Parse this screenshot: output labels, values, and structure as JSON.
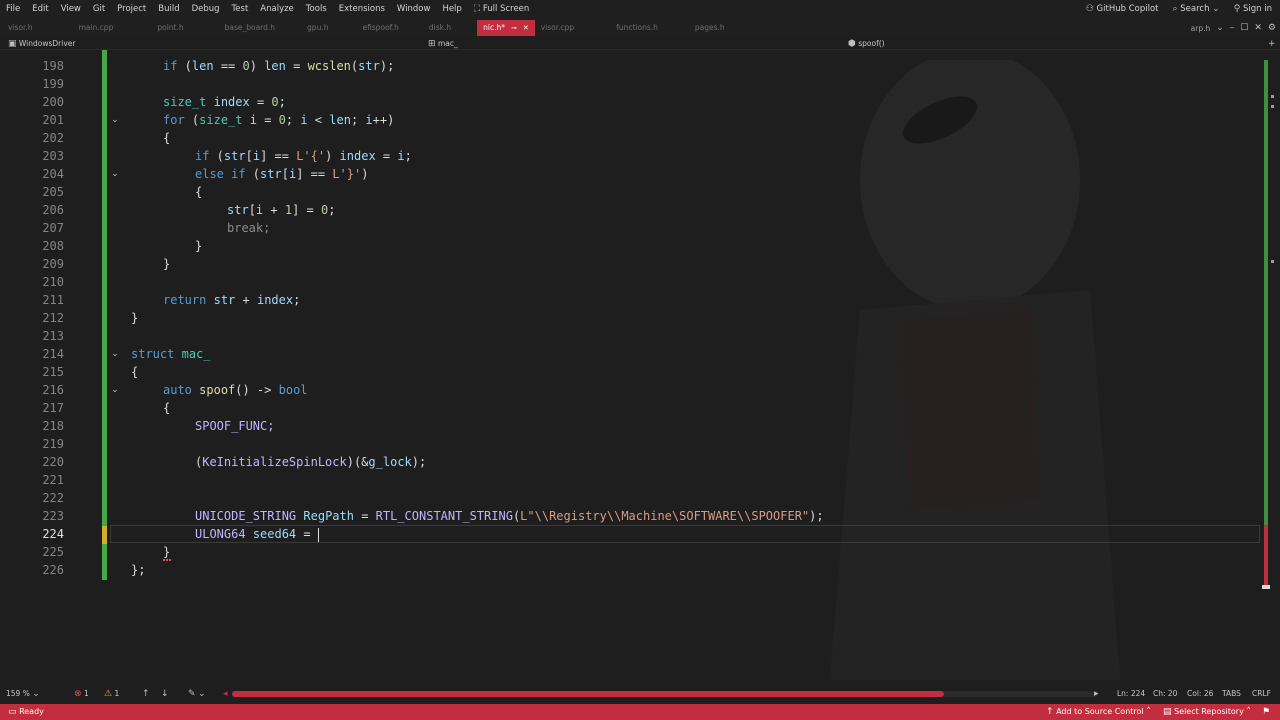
{
  "menu": [
    "File",
    "Edit",
    "View",
    "Git",
    "Project",
    "Build",
    "Debug",
    "Test",
    "Analyze",
    "Tools",
    "Extensions",
    "Window",
    "Help"
  ],
  "fullscreen_label": "Full Screen",
  "copilot_label": "GitHub Copilot",
  "search_label": "Search",
  "signin_label": "Sign in",
  "tabs": [
    "visor.h",
    "main.cpp",
    "point.h",
    "base_board.h",
    "gpu.h",
    "efispoof.h",
    "disk.h",
    "nic.h*",
    "visor.cpp",
    "functions.h",
    "pages.h"
  ],
  "active_tab": "nic.h*",
  "tab_right": "arp.h",
  "nav": {
    "project": "WindowsDriver",
    "scope": "mac_",
    "member": "spoof()"
  },
  "line_numbers": [
    "198",
    "199",
    "200",
    "201",
    "202",
    "203",
    "204",
    "205",
    "206",
    "207",
    "208",
    "209",
    "210",
    "211",
    "212",
    "213",
    "214",
    "215",
    "216",
    "217",
    "218",
    "219",
    "220",
    "221",
    "222",
    "223",
    "224",
    "225",
    "226"
  ],
  "code": {
    "l198": "if (len == 0) len = wcslen(str);",
    "l200": "size_t index = 0;",
    "l201": "for (size_t i = 0; i < len; i++)",
    "l202": "{",
    "l203": "if (str[i] == L'{') index = i;",
    "l204": "else if (str[i] == L'}')",
    "l205": "{",
    "l206": "str[i + 1] = 0;",
    "l207": "break;",
    "l208": "}",
    "l209": "}",
    "l211": "return str + index;",
    "l212": "}",
    "l214": "struct mac_",
    "l215": "{",
    "l216": "auto spoof() -> bool",
    "l217": "{",
    "l218": "SPOOF_FUNC;",
    "l220": "(KeInitializeSpinLock)(&g_lock);",
    "l223": "UNICODE_STRING RegPath = RTL_CONSTANT_STRING(L\"\\\\Registry\\\\Machine\\SOFTWARE\\\\SPOOFER\");",
    "l224": "ULONG64 seed64 = ",
    "l225": "}",
    "l226": "};"
  },
  "status_row": {
    "zoom": "159 %",
    "errors": "1",
    "warnings": "1",
    "ln": "Ln: 224",
    "ch": "Ch: 20",
    "col": "Col: 26",
    "tabs": "TABS",
    "eol": "CRLF"
  },
  "statusbar": {
    "ready": "Ready",
    "source_control": "Add to Source Control",
    "repository": "Select Repository"
  },
  "colors": {
    "accent": "#c22d3f",
    "background": "#1e1e1e",
    "change_green": "#46a845"
  },
  "icons": [
    "copilot-icon",
    "search-icon",
    "person-icon",
    "minimize-icon",
    "maximize-icon",
    "close-icon",
    "error-icon",
    "warning-icon",
    "up-arrow-icon",
    "down-arrow-icon",
    "brush-icon",
    "fold-icon",
    "pin-icon"
  ]
}
